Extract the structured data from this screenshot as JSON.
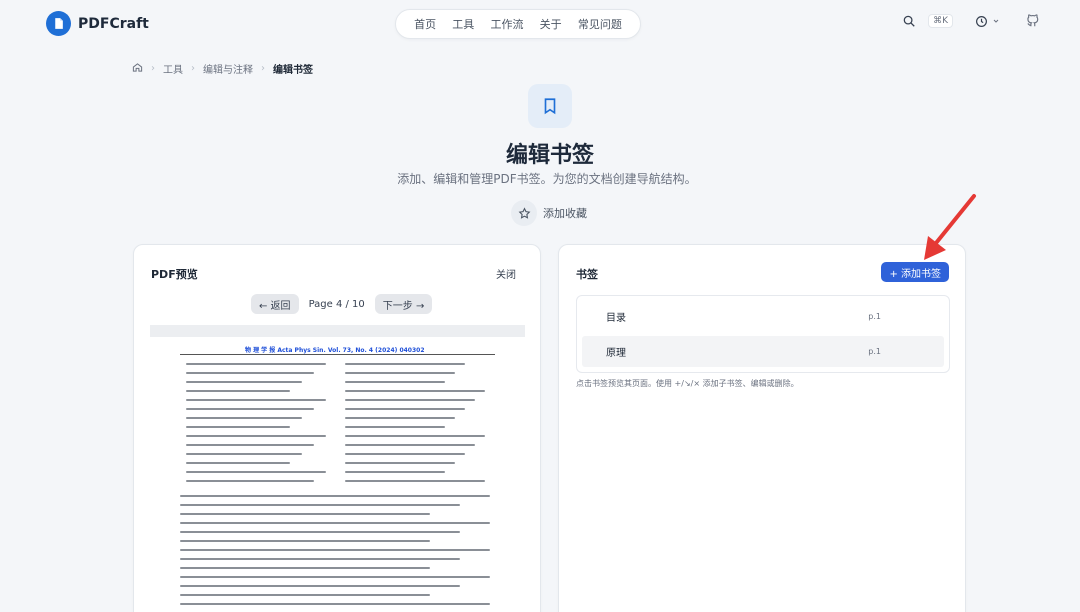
{
  "header": {
    "logo_text": "PDFCraft",
    "nav": [
      "首页",
      "工具",
      "工作流",
      "关于",
      "常见问题"
    ],
    "shortcut": "⌘K"
  },
  "breadcrumb": [
    "工具",
    "编辑与注释",
    "编辑书签"
  ],
  "hero": {
    "title": "编辑书签",
    "subtitle": "添加、编辑和管理PDF书签。为您的文档创建导航结构。",
    "favorite_label": "添加收藏"
  },
  "preview_panel": {
    "title": "PDF预览",
    "close_label": "关闭",
    "back_label": "← 返回",
    "page_text": "Page 4 / 10",
    "next_label": "下一步 →",
    "pdf_header": "物 理 学 报   Acta  Phys  Sin.   Vol. 73, No. 4 (2024)   040302"
  },
  "bookmarks_panel": {
    "title": "书签",
    "add_label": "+ 添加书签",
    "items": [
      {
        "label": "目录",
        "page": "p.1"
      },
      {
        "label": "原理",
        "page": "p.1"
      }
    ],
    "hint": "点击书签预览其页面。使用 +/↘/× 添加子书签、编辑或删除。"
  },
  "colors": {
    "accent": "#2f62d9",
    "arrow": "#e53935"
  }
}
